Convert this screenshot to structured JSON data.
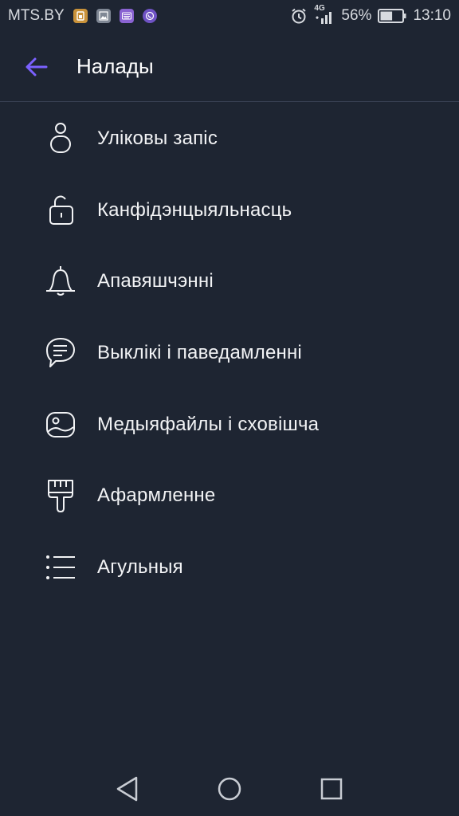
{
  "status_bar": {
    "carrier": "MTS.BY",
    "network": "4G",
    "battery_percent": "56%",
    "time": "13:10",
    "notification_icons": [
      "sim-icon",
      "gallery-icon",
      "keyboard-icon",
      "viber-icon"
    ]
  },
  "app_bar": {
    "title": "Налады"
  },
  "settings": {
    "items": [
      {
        "icon": "account-icon",
        "label": "Уліковы запіс"
      },
      {
        "icon": "lock-icon",
        "label": "Канфідэнцыяльнасць"
      },
      {
        "icon": "bell-icon",
        "label": "Апавяшчэнні"
      },
      {
        "icon": "chat-icon",
        "label": "Выклікі і паведамленні"
      },
      {
        "icon": "media-icon",
        "label": "Медыяфайлы і сховішча"
      },
      {
        "icon": "brush-icon",
        "label": "Афармленне"
      },
      {
        "icon": "list-icon",
        "label": "Агульныя"
      }
    ]
  },
  "colors": {
    "background": "#1e2532",
    "accent": "#7b61ff",
    "divider": "#394254",
    "text": "#f2f3f5"
  }
}
